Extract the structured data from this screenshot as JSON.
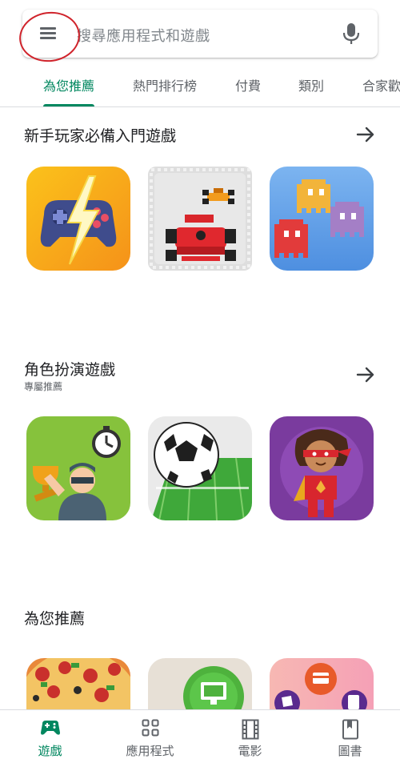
{
  "search": {
    "placeholder": "搜尋應用程式和遊戲",
    "menu_icon": "menu-icon",
    "mic_icon": "mic-icon"
  },
  "tabs": [
    {
      "label": "為您推薦",
      "active": true
    },
    {
      "label": "熱門排行榜",
      "active": false
    },
    {
      "label": "付費",
      "active": false
    },
    {
      "label": "類別",
      "active": false
    },
    {
      "label": "合家歡",
      "active": false
    }
  ],
  "sections": [
    {
      "title": "新手玩家必備入門遊戲",
      "subtitle": "",
      "arrow": "arrow-right-icon",
      "apps": [
        "gamepad-lightning-icon",
        "race-cars-icon",
        "pixel-ghosts-icon"
      ]
    },
    {
      "title": "角色扮演遊戲",
      "subtitle": "專屬推薦",
      "arrow": "arrow-right-icon",
      "apps": [
        "trophy-stopwatch-icon",
        "soccer-ball-field-icon",
        "superhero-kid-icon"
      ]
    },
    {
      "title": "為您推薦",
      "subtitle": "",
      "apps": [
        "pizza-icon",
        "monitor-icon",
        "map-pins-icon"
      ]
    }
  ],
  "bottom_nav": [
    {
      "label": "遊戲",
      "icon": "gamepad-icon",
      "active": true
    },
    {
      "label": "應用程式",
      "icon": "apps-grid-icon",
      "active": false
    },
    {
      "label": "電影",
      "icon": "film-icon",
      "active": false
    },
    {
      "label": "圖書",
      "icon": "book-icon",
      "active": false
    }
  ],
  "colors": {
    "accent": "#01875f",
    "annotation": "#d0232b",
    "text": "#202124",
    "secondary": "#5f6368"
  }
}
